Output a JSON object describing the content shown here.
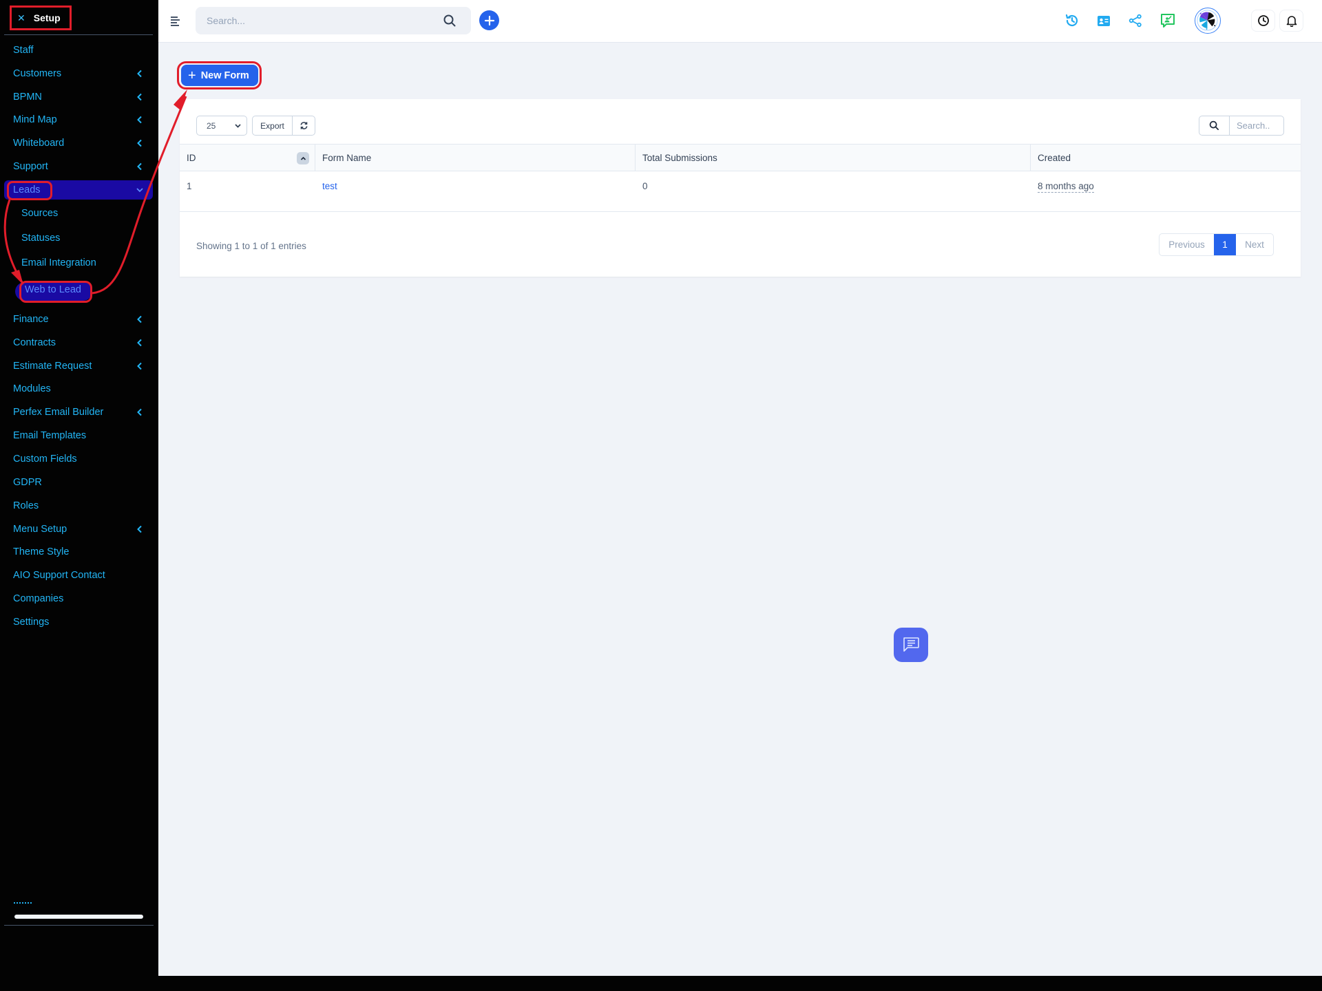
{
  "sidebar": {
    "header": {
      "close_icon": "close-icon",
      "title": "Setup"
    },
    "items": [
      {
        "label": "Staff",
        "has_chevron": false
      },
      {
        "label": "Customers",
        "has_chevron": true
      },
      {
        "label": "BPMN",
        "has_chevron": true
      },
      {
        "label": "Mind Map",
        "has_chevron": true
      },
      {
        "label": "Whiteboard",
        "has_chevron": true
      },
      {
        "label": "Support",
        "has_chevron": true
      },
      {
        "label": "Leads",
        "has_chevron": true,
        "expanded": true,
        "active": true
      },
      {
        "label": "Sources",
        "sub": true
      },
      {
        "label": "Statuses",
        "sub": true
      },
      {
        "label": "Email Integration",
        "sub": true
      },
      {
        "label": "Web to Lead",
        "sub": true,
        "active": true
      },
      {
        "label": "Finance",
        "has_chevron": true
      },
      {
        "label": "Contracts",
        "has_chevron": true
      },
      {
        "label": "Estimate Request",
        "has_chevron": true
      },
      {
        "label": "Modules",
        "has_chevron": false
      },
      {
        "label": "Perfex Email Builder",
        "has_chevron": true
      },
      {
        "label": "Email Templates",
        "has_chevron": false
      },
      {
        "label": "Custom Fields",
        "has_chevron": false
      },
      {
        "label": "GDPR",
        "has_chevron": false
      },
      {
        "label": "Roles",
        "has_chevron": false
      },
      {
        "label": "Menu Setup",
        "has_chevron": true
      },
      {
        "label": "Theme Style",
        "has_chevron": false
      },
      {
        "label": "AIO Support Contact",
        "has_chevron": false
      },
      {
        "label": "Companies",
        "has_chevron": false
      },
      {
        "label": "Settings",
        "has_chevron": false
      }
    ]
  },
  "topbar": {
    "search_placeholder": "Search...",
    "icons": [
      "menu-icon",
      "search-icon",
      "add-icon",
      "history-icon",
      "contact-card-icon",
      "share-icon",
      "presentation-icon",
      "avatar",
      "clock-icon",
      "bell-icon"
    ]
  },
  "main": {
    "new_form_label": "New Form",
    "table": {
      "page_length": "25",
      "export_label": "Export",
      "search_placeholder": "Search..",
      "columns": [
        "ID",
        "Form Name",
        "Total Submissions",
        "Created"
      ],
      "rows": [
        {
          "id": "1",
          "form_name": "test",
          "total_submissions": "0",
          "created": "8 months ago"
        }
      ],
      "info": "Showing 1 to 1 of 1 entries",
      "pagination": {
        "previous": "Previous",
        "current": "1",
        "next": "Next"
      }
    }
  },
  "colors": {
    "accent": "#2563eb",
    "sidebar_bg": "#030303",
    "sidebar_text": "#22b5f5",
    "sidebar_active_bg": "#1a0aa3",
    "annotation": "#e11d2a",
    "chat_button": "#5268ee"
  }
}
